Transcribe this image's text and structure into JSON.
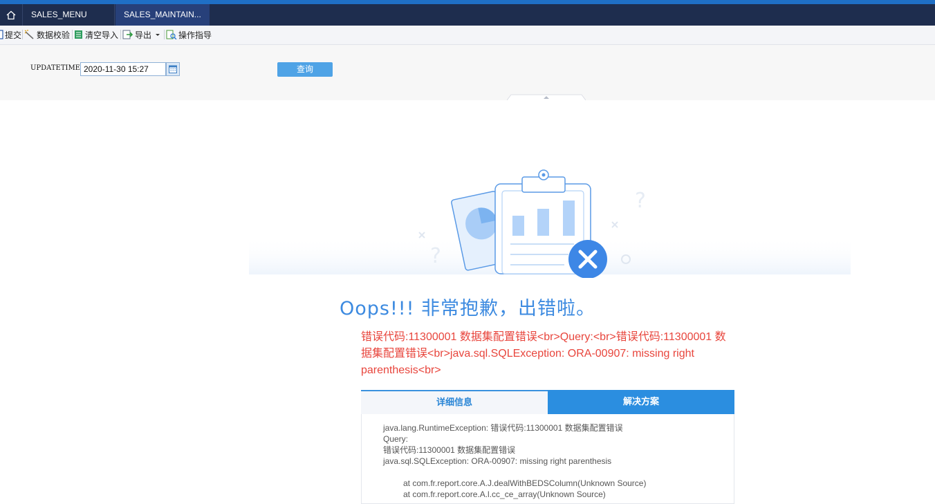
{
  "tabs": [
    "SALES_MENU",
    "SALES_MAINTAIN..."
  ],
  "toolbar": {
    "submit": "提交",
    "validate": "数据校验",
    "clear_import": "清空导入",
    "export": "导出",
    "guide": "操作指导"
  },
  "params": {
    "label": "UPDATETIME:",
    "value": "2020-11-30 15:27",
    "query_button": "查询"
  },
  "error": {
    "title": "Oops!!! 非常抱歉，出错啦。",
    "message": "错误代码:11300001 数据集配置错误<br>Query:<br>错误代码:11300001 数据集配置错误<br>java.sql.SQLException: ORA-00907: missing right parenthesis<br>",
    "tab_details": "详细信息",
    "tab_solution": "解决方案",
    "details_lines": [
      "java.lang.RuntimeException: 错误代码:11300001 数据集配置错误",
      "Query:",
      "错误代码:11300001 数据集配置错误",
      "java.sql.SQLException: ORA-00907: missing right parenthesis",
      "",
      "at com.fr.report.core.A.J.dealWithBEDSColumn(Unknown Source)",
      "at com.fr.report.core.A.l.cc_ce_array(Unknown Source)"
    ]
  },
  "colors": {
    "accent": "#3c8ae0",
    "error": "#e8453c",
    "header_bg": "#1e2d4e"
  }
}
